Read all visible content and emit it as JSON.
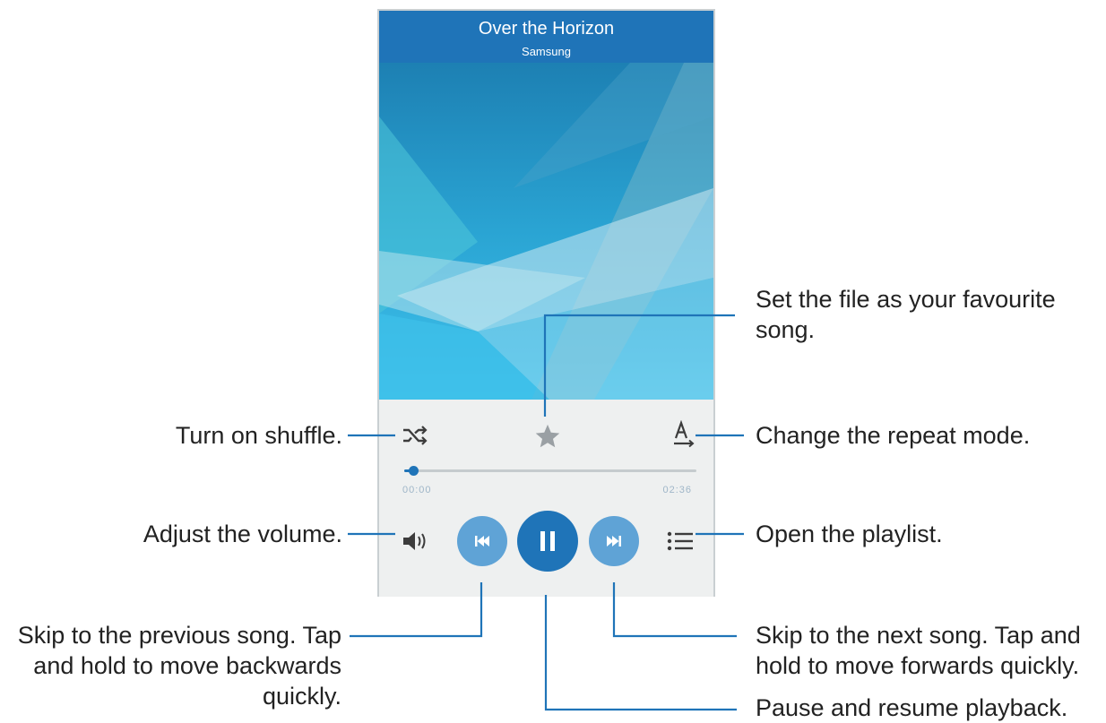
{
  "now_playing": {
    "title": "Over the Horizon",
    "artist": "Samsung",
    "elapsed": "00:00",
    "duration": "02:36",
    "progress": 0.03,
    "colors": {
      "header": "#1f74b8",
      "accent": "#1f74b8",
      "button_light": "#5fa3d6"
    }
  },
  "controls": {
    "shuffle": {
      "icon": "shuffle-icon"
    },
    "favourite": {
      "icon": "star-icon"
    },
    "repeat": {
      "icon": "repeat-a-icon"
    },
    "volume": {
      "icon": "volume-icon"
    },
    "previous": {
      "icon": "skip-previous-icon"
    },
    "play_pause": {
      "icon": "pause-icon"
    },
    "next": {
      "icon": "skip-next-icon"
    },
    "playlist": {
      "icon": "playlist-icon"
    }
  },
  "callouts": {
    "favourite": [
      "Set the file as your favourite",
      "song."
    ],
    "shuffle": "Turn on shuffle.",
    "repeat": "Change the repeat mode.",
    "volume": "Adjust the volume.",
    "playlist": "Open the playlist.",
    "previous": [
      "Skip to the previous song. Tap",
      "and hold to move backwards",
      "quickly."
    ],
    "next": [
      "Skip to the next song. Tap and",
      "hold to move forwards quickly."
    ],
    "pause": "Pause and resume playback."
  }
}
